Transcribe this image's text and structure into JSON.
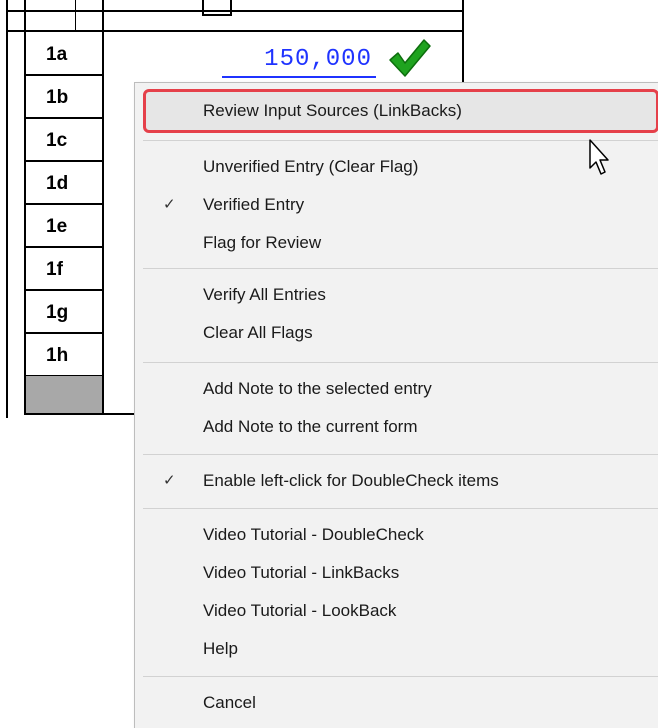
{
  "form": {
    "rows": [
      "1a",
      "1b",
      "1c",
      "1d",
      "1e",
      "1f",
      "1g",
      "1h"
    ],
    "value_1a": "150,000",
    "verified_icon": "green-checkmark-icon",
    "verified_color": "#1fa31f"
  },
  "context_menu": {
    "highlight_border_color": "#e5404a",
    "items": [
      {
        "label": "Review Input Sources (LinkBacks)",
        "checked": false
      },
      {
        "label": "Unverified Entry (Clear Flag)",
        "checked": false
      },
      {
        "label": "Verified Entry",
        "checked": true
      },
      {
        "label": "Flag for Review",
        "checked": false
      },
      {
        "label": "Verify All Entries",
        "checked": false
      },
      {
        "label": "Clear All Flags",
        "checked": false
      },
      {
        "label": "Add Note to the selected entry",
        "checked": false
      },
      {
        "label": "Add Note to the current form",
        "checked": false
      },
      {
        "label": "Enable left-click for DoubleCheck items",
        "checked": true
      },
      {
        "label": "Video Tutorial - DoubleCheck",
        "checked": false
      },
      {
        "label": "Video Tutorial - LinkBacks",
        "checked": false
      },
      {
        "label": "Video Tutorial - LookBack",
        "checked": false
      },
      {
        "label": "Help",
        "checked": false
      },
      {
        "label": "Cancel",
        "checked": false
      }
    ],
    "check_glyph": "✓"
  }
}
